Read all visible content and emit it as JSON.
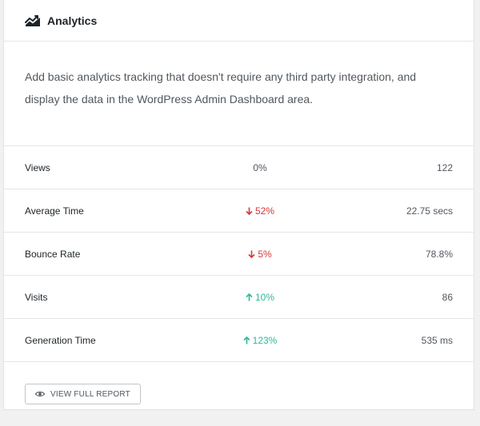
{
  "header": {
    "title": "Analytics",
    "icon": "analytics-chart-icon"
  },
  "description": "Add basic analytics tracking that doesn't require any third party integration, and display the data in the WordPress Admin Dashboard area.",
  "stats": [
    {
      "label": "Views",
      "change": "0%",
      "direction": "none",
      "value": "122"
    },
    {
      "label": "Average Time",
      "change": "52%",
      "direction": "down",
      "value": "22.75 secs"
    },
    {
      "label": "Bounce Rate",
      "change": "5%",
      "direction": "down",
      "value": "78.8%"
    },
    {
      "label": "Visits",
      "change": "10%",
      "direction": "up",
      "value": "86"
    },
    {
      "label": "Generation Time",
      "change": "123%",
      "direction": "up",
      "value": "535 ms"
    }
  ],
  "footer": {
    "report_button_label": "VIEW FULL REPORT",
    "report_button_icon": "eye-icon"
  },
  "colors": {
    "down": "#d63638",
    "up": "#2eb89a",
    "neutral": "#50575e"
  }
}
